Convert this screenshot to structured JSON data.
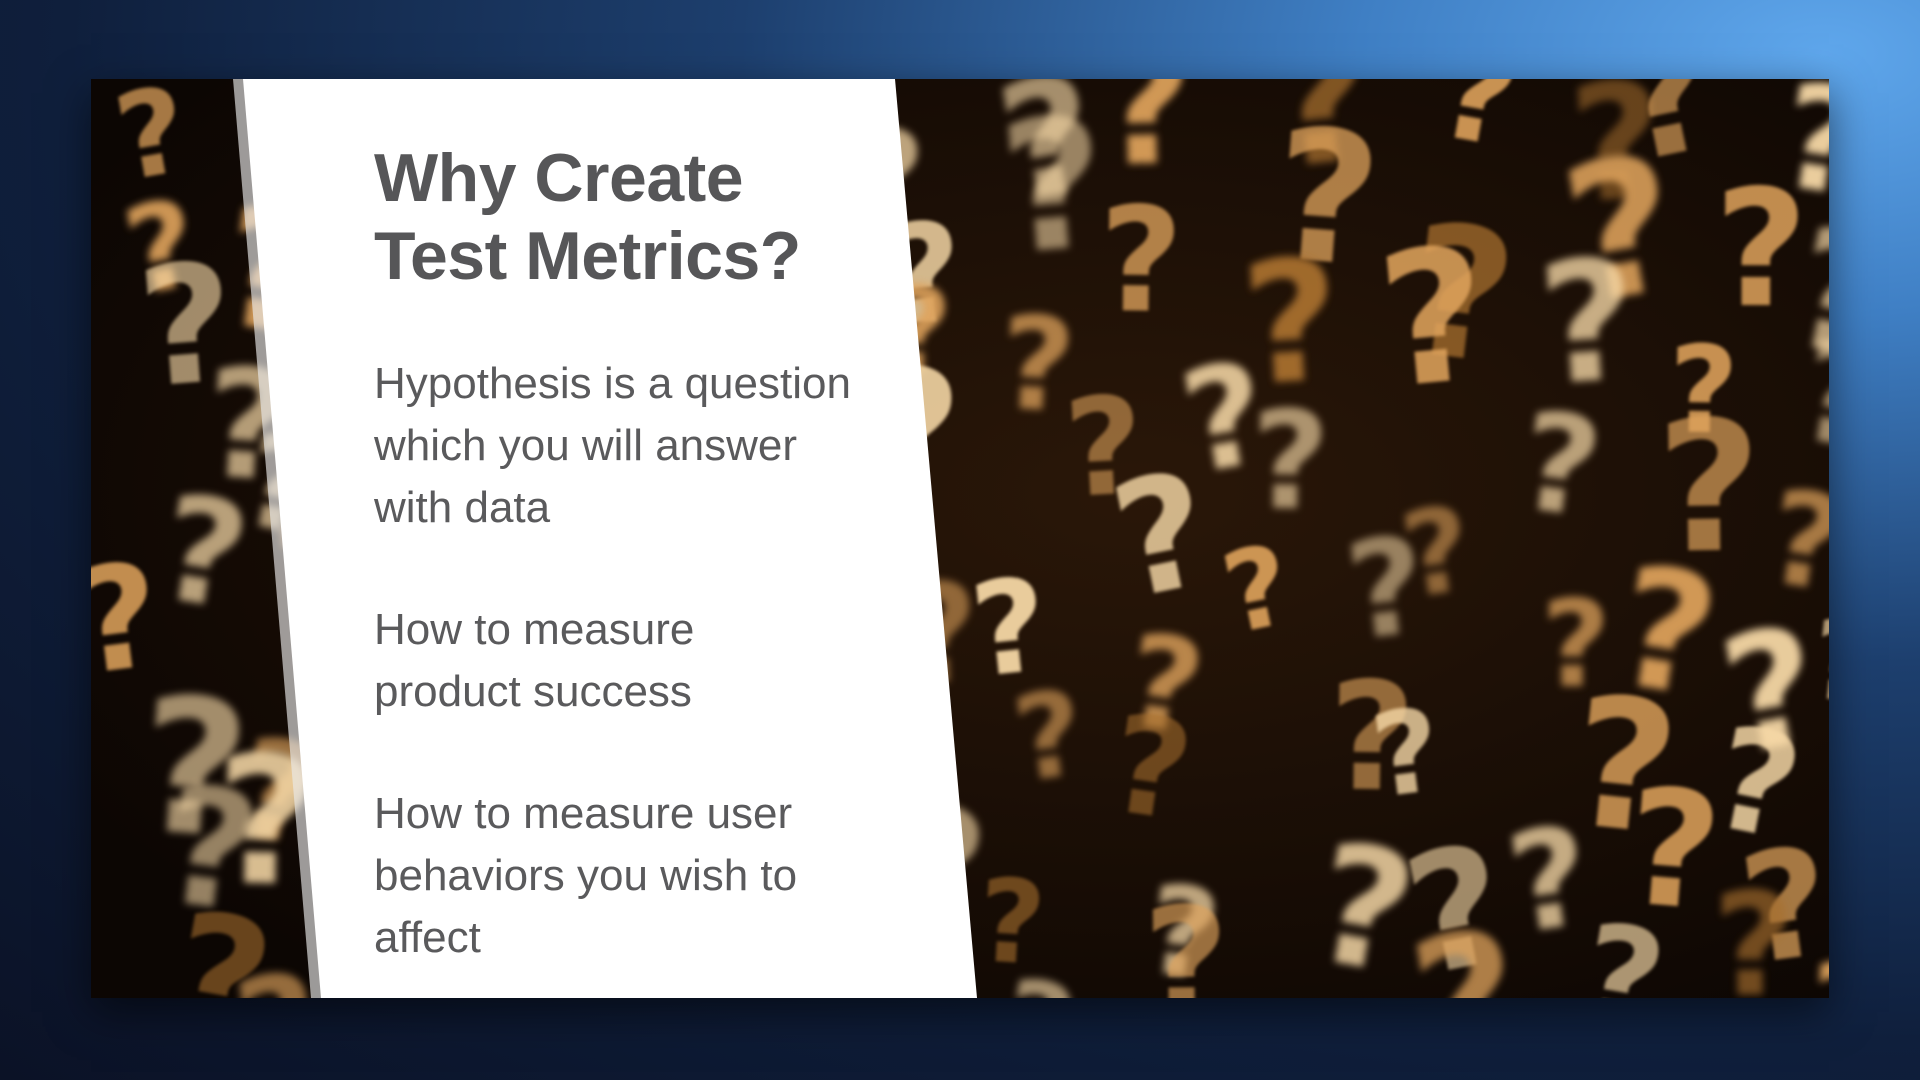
{
  "slide": {
    "title": "Why Create Test Metrics?",
    "bullets": [
      "Hypothesis is a question which you will answer with data",
      "How to measure product success",
      "How to measure user behaviors you wish to affect"
    ]
  },
  "background": {
    "image_subject": "bokeh-question-marks",
    "glyph": "?",
    "colors": {
      "backdrop": "#130b05",
      "glow_light": "#f6d8a6",
      "glow_mid": "#dfa35c",
      "glow_dark": "#a86f2e",
      "panel": "#ffffff",
      "text": "#58585a"
    }
  }
}
